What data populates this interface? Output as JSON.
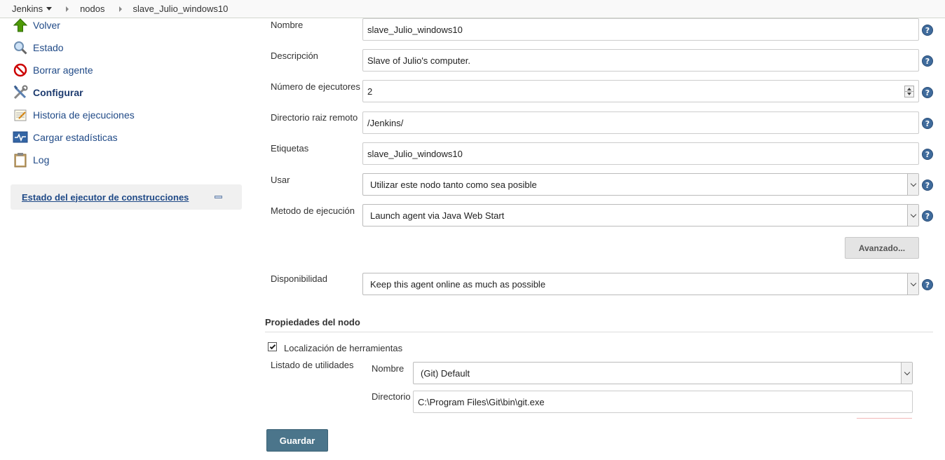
{
  "breadcrumb": {
    "items": [
      "Jenkins",
      "nodos",
      "slave_Julio_windows10"
    ]
  },
  "sidebar": {
    "items": [
      {
        "label": "Volver",
        "icon": "up-arrow-icon"
      },
      {
        "label": "Estado",
        "icon": "magnifier-icon"
      },
      {
        "label": "Borrar agente",
        "icon": "no-entry-icon"
      },
      {
        "label": "Configurar",
        "icon": "wrench-screwdriver-icon"
      },
      {
        "label": "Historia de ejecuciones",
        "icon": "notepad-icon"
      },
      {
        "label": "Cargar estadísticas",
        "icon": "monitor-graph-icon"
      },
      {
        "label": "Log",
        "icon": "clipboard-icon"
      }
    ],
    "executor_panel": "Estado del ejecutor de construcciones"
  },
  "form": {
    "nombre": {
      "label": "Nombre",
      "value": "slave_Julio_windows10"
    },
    "descripcion": {
      "label": "Descripción",
      "value": "Slave of Julio's computer."
    },
    "ejecutores": {
      "label": "Número de ejecutores",
      "value": "2"
    },
    "directorio": {
      "label": "Directorio raiz remoto",
      "value": "/Jenkins/"
    },
    "etiquetas": {
      "label": "Etiquetas",
      "value": "slave_Julio_windows10"
    },
    "usar": {
      "label": "Usar",
      "value": "Utilizar este nodo tanto como sea posible"
    },
    "metodo": {
      "label": "Metodo de ejecución",
      "value": "Launch agent via Java Web Start"
    },
    "avanzado_button": "Avanzado...",
    "disponibilidad": {
      "label": "Disponibilidad",
      "value": "Keep this agent online as much as possible"
    },
    "help_glyph": "?"
  },
  "propiedades": {
    "title": "Propiedades del nodo",
    "localizacion_label": "Localización de herramientas",
    "localizacion_checked": true,
    "listado_label": "Listado de utilidades",
    "tool_nombre": {
      "label": "Nombre",
      "value": "(Git) Default"
    },
    "tool_directorio": {
      "label": "Directorio",
      "value": "C:\\Program Files\\Git\\bin\\git.exe"
    }
  },
  "save_button": "Guardar",
  "colors": {
    "link": "#204a87",
    "save_button": "#4b758b",
    "help_icon": "#3f6b9c"
  }
}
